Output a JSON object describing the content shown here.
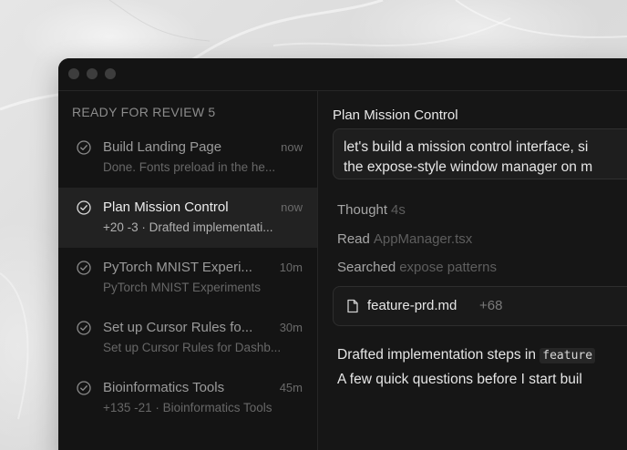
{
  "sidebar": {
    "section_title": "READY FOR REVIEW",
    "section_count": "5",
    "tasks": [
      {
        "title": "Build Landing Page",
        "time": "now",
        "subtitle": "Done. Fonts preload in the he...",
        "selected": false
      },
      {
        "title": "Plan Mission Control",
        "time": "now",
        "subtitle": "+20 -3 · Drafted implementati...",
        "selected": true
      },
      {
        "title": "PyTorch MNIST Experi...",
        "time": "10m",
        "subtitle": "PyTorch MNIST Experiments",
        "selected": false
      },
      {
        "title": "Set up Cursor Rules fo...",
        "time": "30m",
        "subtitle": "Set up Cursor Rules for Dashb...",
        "selected": false
      },
      {
        "title": "Bioinformatics Tools",
        "time": "45m",
        "subtitle": "+135 -21 · Bioinformatics Tools",
        "selected": false
      }
    ]
  },
  "main": {
    "title": "Plan Mission Control",
    "prompt_line1": "let's build a mission control interface, si",
    "prompt_line2": "the expose-style window manager on m",
    "steps": [
      {
        "label": "Thought",
        "detail": "4s"
      },
      {
        "label": "Read",
        "detail": "AppManager.tsx"
      },
      {
        "label": "Searched",
        "detail": "expose patterns"
      }
    ],
    "file": {
      "name": "feature-prd.md",
      "delta": "+68",
      "icon": "file-icon"
    },
    "response_line1_text": "Drafted implementation steps in ",
    "response_line1_code": "feature",
    "response_line2": "A few quick questions before I start buil"
  },
  "colors": {
    "window_bg": "#161616",
    "sidebar_bg": "#141414",
    "selected_bg": "#222222",
    "text_primary": "#e6e6e6",
    "text_muted": "#676767"
  }
}
